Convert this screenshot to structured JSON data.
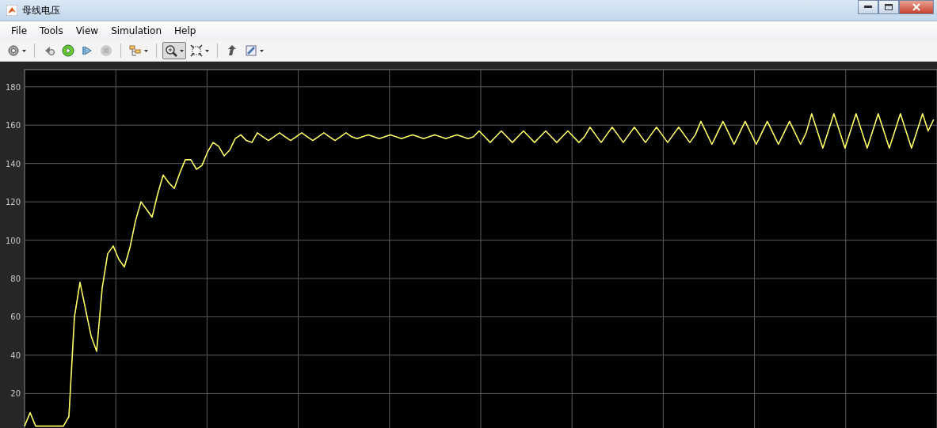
{
  "window": {
    "title": "母线电压"
  },
  "menu": [
    {
      "label": "File"
    },
    {
      "label": "Tools"
    },
    {
      "label": "View"
    },
    {
      "label": "Simulation"
    },
    {
      "label": "Help"
    }
  ],
  "toolbar": [
    [
      {
        "selected": false,
        "disabled": false,
        "dropdown": true
      }
    ],
    [
      {
        "selected": false,
        "disabled": false,
        "dropdown": false
      },
      {
        "selected": false,
        "disabled": false,
        "dropdown": false
      },
      {
        "selected": false,
        "disabled": false,
        "dropdown": false
      },
      {
        "selected": false,
        "disabled": true,
        "dropdown": false
      }
    ],
    [
      {
        "selected": false,
        "disabled": false,
        "dropdown": true
      }
    ],
    [
      {
        "selected": true,
        "disabled": false,
        "dropdown": true
      },
      {
        "selected": false,
        "disabled": false,
        "dropdown": true
      }
    ],
    [
      {
        "selected": false,
        "disabled": false,
        "dropdown": false
      },
      {
        "selected": false,
        "disabled": false,
        "dropdown": true
      }
    ]
  ],
  "plot": {
    "chart_data": {
      "type": "line",
      "grid": true,
      "ylim": [
        2,
        189
      ],
      "yticks": [
        20,
        40,
        60,
        80,
        100,
        120,
        140,
        160,
        180
      ],
      "series": [
        {
          "color": "#ffff66",
          "values": [
            3,
            10,
            3,
            3,
            3,
            3,
            3,
            3,
            8,
            60,
            78,
            64,
            50,
            42,
            75,
            93,
            97,
            90,
            86,
            96,
            110,
            120,
            116,
            112,
            124,
            134,
            130,
            127,
            135,
            142,
            142,
            137,
            139,
            146,
            151,
            149,
            144,
            147,
            153,
            155,
            152,
            151,
            156,
            154,
            152,
            154,
            156,
            154,
            152,
            154,
            156,
            154,
            152,
            154,
            156,
            154,
            152,
            154,
            156,
            154,
            153,
            154,
            155,
            154,
            153,
            154,
            155,
            154,
            153,
            154,
            155,
            154,
            153,
            154,
            155,
            154,
            153,
            154,
            155,
            154,
            153,
            154,
            157,
            154,
            151,
            154,
            157,
            154,
            151,
            154,
            157,
            154,
            151,
            154,
            157,
            154,
            151,
            154,
            157,
            154,
            151,
            154,
            159,
            155,
            151,
            155,
            159,
            155,
            151,
            155,
            159,
            155,
            151,
            155,
            159,
            155,
            151,
            155,
            159,
            155,
            151,
            155,
            162,
            156,
            150,
            156,
            162,
            156,
            150,
            156,
            162,
            156,
            150,
            156,
            162,
            156,
            150,
            156,
            162,
            156,
            150,
            156,
            166,
            157,
            148,
            157,
            166,
            157,
            148,
            157,
            166,
            157,
            148,
            157,
            166,
            157,
            148,
            157,
            166,
            157,
            148,
            157,
            166,
            157,
            163
          ]
        }
      ]
    }
  }
}
